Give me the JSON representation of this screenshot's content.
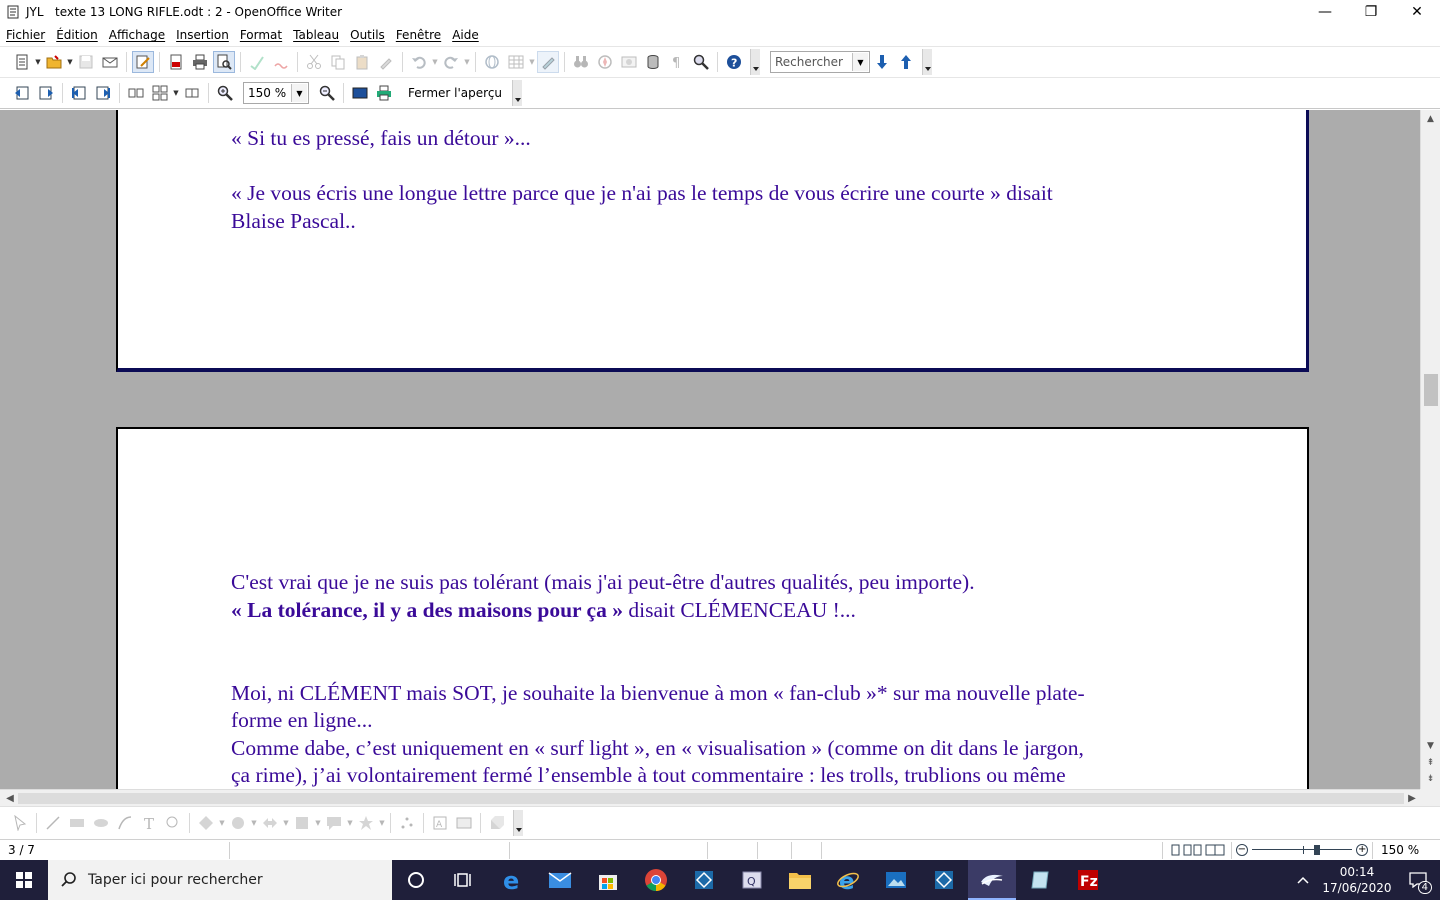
{
  "window": {
    "title": "JYL   texte 13 LONG RIFLE.odt : 2 - OpenOffice Writer",
    "minimize": "—",
    "maximize": "❐",
    "close": "✕"
  },
  "menu": [
    "Fichier",
    "Édition",
    "Affichage",
    "Insertion",
    "Format",
    "Tableau",
    "Outils",
    "Fenêtre",
    "Aide"
  ],
  "toolbar": {
    "search_value": "Rechercher"
  },
  "preview_toolbar": {
    "zoom_value": "150 %",
    "close_preview_label": "Fermer l'aperçu"
  },
  "document": {
    "page1": {
      "line1": "« Si tu es pressé, fais un détour »...",
      "line2": "« Je vous écris une longue lettre parce que je n'ai pas le temps de vous écrire une courte » disait",
      "line3": "Blaise Pascal.."
    },
    "page2": {
      "line1": "C'est vrai que je ne suis pas tolérant (mais j'ai peut-être d'autres qualités, peu importe).",
      "line2_bold": "« La tolérance, il y a des maisons pour ça »",
      "line2_rest": " disait CLÉMENCEAU !...",
      "line3": "Moi, ni CLÉMENT mais SOT, je souhaite la bienvenue à mon « fan-club »* sur ma nouvelle plate-",
      "line4": "forme en ligne...",
      "line5": "Comme dabe, c’est uniquement en « surf light », en « visualisation » (comme on dit dans le jargon,",
      "line6": "ça rime), j’ai volontairement fermé l’ensemble à tout commentaire : les trolls, trublions ou même"
    }
  },
  "status": {
    "page": "3 / 7",
    "zoom": "150 %"
  },
  "taskbar": {
    "search_placeholder": "Taper ici pour rechercher",
    "time": "00:14",
    "date": "17/06/2020",
    "notifications": "4"
  }
}
